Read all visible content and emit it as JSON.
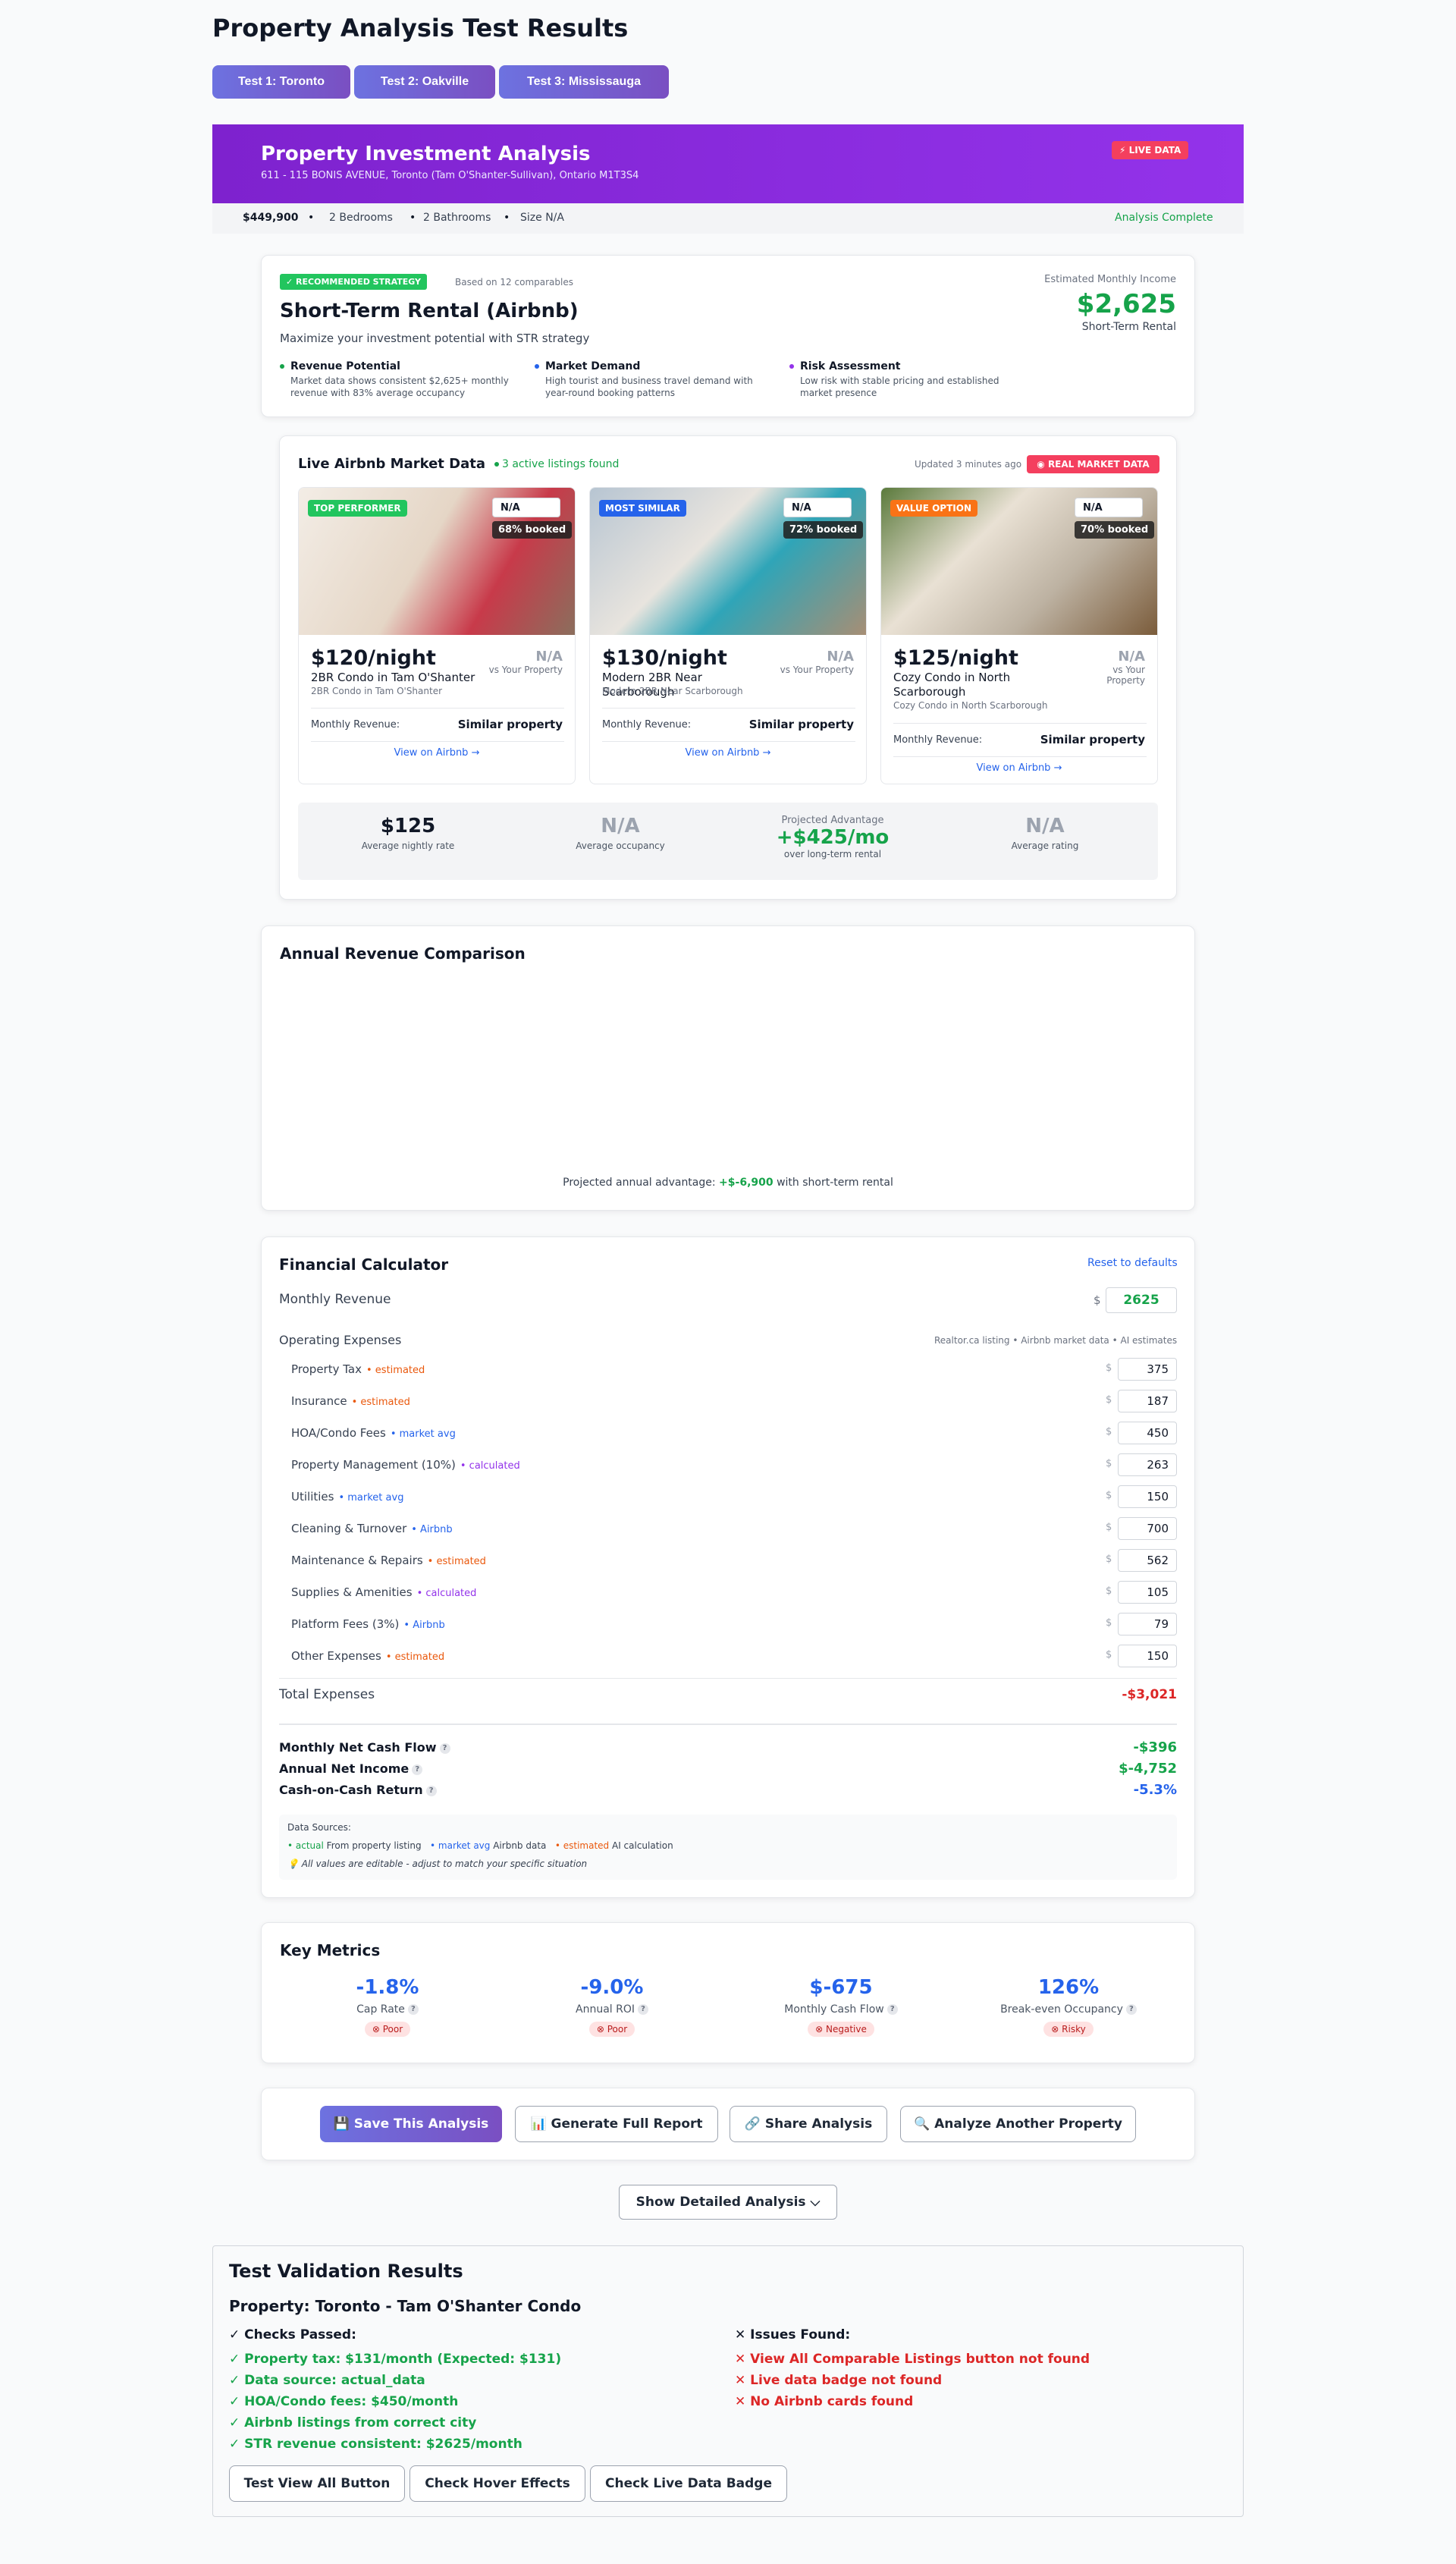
{
  "page_title": "Property Analysis Test Results",
  "tabs": [
    "Test 1: Toronto",
    "Test 2: Oakville",
    "Test 3: Mississauga"
  ],
  "banner": {
    "title": "Property Investment Analysis",
    "address": "611 - 115 BONIS AVENUE, Toronto (Tam O'Shanter-Sullivan), Ontario M1T3S4",
    "live_badge": "⚡ LIVE DATA"
  },
  "summary": {
    "price": "$449,900",
    "bedrooms": "2 Bedrooms",
    "bathrooms": "2 Bathrooms",
    "size": "Size N/A",
    "status": "Analysis Complete"
  },
  "strategy": {
    "badge": "✓ RECOMMENDED STRATEGY",
    "based_on": "Based on 12 comparables",
    "title": "Short-Term Rental (Airbnb)",
    "subtitle": "Maximize your investment potential with STR strategy",
    "income_label": "Estimated Monthly Income",
    "income_value": "$2,625",
    "income_type": "Short-Term Rental",
    "points": [
      {
        "title": "Revenue Potential",
        "text": "Market data shows consistent $2,625+ monthly revenue with 83% average occupancy",
        "color": "#16a34a"
      },
      {
        "title": "Market Demand",
        "text": "High tourist and business travel demand with year-round booking patterns",
        "color": "#2563eb"
      },
      {
        "title": "Risk Assessment",
        "text": "Low risk with stable pricing and established market presence",
        "color": "#9333ea"
      }
    ]
  },
  "market": {
    "title": "Live Airbnb Market Data",
    "active": "3 active listings found",
    "updated": "Updated 3 minutes ago",
    "real_badge": "◉ REAL MARKET DATA",
    "listings": [
      {
        "badge": "TOP PERFORMER",
        "badge_color": "#22c55e",
        "na": "N/A",
        "booked": "68% booked",
        "price": "$120/night",
        "title": "2BR Condo in Tam O'Shanter",
        "sub": "2BR Condo in Tam O'Shanter",
        "vs_na": "N/A",
        "vs": "vs Your Property",
        "rev_label": "Monthly Revenue:",
        "rev_value": "Similar property",
        "link": "View on Airbnb →"
      },
      {
        "badge": "MOST SIMILAR",
        "badge_color": "#2563eb",
        "na": "N/A",
        "booked": "72% booked",
        "price": "$130/night",
        "title": "Modern 2BR Near Scarborough",
        "sub": "Modern 2BR Near Scarborough",
        "vs_na": "N/A",
        "vs": "vs Your Property",
        "rev_label": "Monthly Revenue:",
        "rev_value": "Similar property",
        "link": "View on Airbnb →"
      },
      {
        "badge": "VALUE OPTION",
        "badge_color": "#f97316",
        "na": "N/A",
        "booked": "70% booked",
        "price": "$125/night",
        "title": "Cozy Condo in North Scarborough",
        "sub": "Cozy Condo in North Scarborough",
        "vs_na": "N/A",
        "vs": "vs Your Property",
        "rev_label": "Monthly Revenue:",
        "rev_value": "Similar property",
        "link": "View on Airbnb →"
      }
    ],
    "stats": [
      {
        "value": "$125",
        "label": "Average nightly rate"
      },
      {
        "value": "N/A",
        "label": "Average occupancy"
      },
      {
        "top": "Projected Advantage",
        "value": "+$425/mo",
        "label": "over long-term rental"
      },
      {
        "value": "N/A",
        "label": "Average rating"
      }
    ]
  },
  "revenue": {
    "title": "Annual Revenue Comparison",
    "footer_pre": "Projected annual advantage: ",
    "footer_val": "+$-6,900",
    "footer_post": " with short-term rental"
  },
  "calculator": {
    "title": "Financial Calculator",
    "reset": "Reset to defaults",
    "monthly_revenue_label": "Monthly Revenue",
    "monthly_revenue": "2625",
    "opex_label": "Operating Expenses",
    "opex_sources": "Realtor.ca listing • Airbnb market data • AI estimates",
    "expenses": [
      {
        "label": "Property Tax",
        "tag": "• estimated",
        "tag_type": "estimated",
        "value": "375"
      },
      {
        "label": "Insurance",
        "tag": "• estimated",
        "tag_type": "estimated",
        "value": "187"
      },
      {
        "label": "HOA/Condo Fees",
        "tag": "• market avg",
        "tag_type": "market",
        "value": "450"
      },
      {
        "label": "Property Management (10%)",
        "tag": "• calculated",
        "tag_type": "calculated",
        "value": "263"
      },
      {
        "label": "Utilities",
        "tag": "• market avg",
        "tag_type": "market",
        "value": "150"
      },
      {
        "label": "Cleaning & Turnover",
        "tag": "• Airbnb",
        "tag_type": "market",
        "value": "700"
      },
      {
        "label": "Maintenance & Repairs",
        "tag": "• estimated",
        "tag_type": "estimated",
        "value": "562"
      },
      {
        "label": "Supplies & Amenities",
        "tag": "• calculated",
        "tag_type": "calculated",
        "value": "105"
      },
      {
        "label": "Platform Fees (3%)",
        "tag": "• Airbnb",
        "tag_type": "market",
        "value": "79"
      },
      {
        "label": "Other Expenses",
        "tag": "• estimated",
        "tag_type": "estimated",
        "value": "150"
      }
    ],
    "currency": "$",
    "total_label": "Total Expenses",
    "total_value": "-$3,021",
    "net_cf_label": "Monthly Net Cash Flow",
    "net_cf_value": "-$396",
    "annual_label": "Annual Net Income",
    "annual_value": "$-4,752",
    "coc_label": "Cash-on-Cash Return",
    "coc_value": "-5.3%",
    "sources_title": "Data Sources:",
    "src_actual": "• actual",
    "src_actual_t": " From property listing",
    "src_market": "• market avg",
    "src_market_t": " Airbnb data",
    "src_est": "• estimated",
    "src_est_t": " AI calculation",
    "note": "💡 All values are editable - adjust to match your specific situation"
  },
  "metrics": {
    "title": "Key Metrics",
    "items": [
      {
        "value": "-1.8%",
        "label": "Cap Rate",
        "pill": "⊗ Poor"
      },
      {
        "value": "-9.0%",
        "label": "Annual ROI",
        "pill": "⊗ Poor"
      },
      {
        "value": "$-675",
        "label": "Monthly Cash Flow",
        "pill": "⊗ Negative"
      },
      {
        "value": "126%",
        "label": "Break-even Occupancy",
        "pill": "⊗ Risky"
      }
    ]
  },
  "actions": [
    "💾 Save This Analysis",
    "📊 Generate Full Report",
    "🔗 Share Analysis",
    "🔍 Analyze Another Property"
  ],
  "show_detailed": "Show Detailed Analysis",
  "validation": {
    "title": "Test Validation Results",
    "property": "Property: Toronto - Tam O'Shanter Condo",
    "passed_title": "✓ Checks Passed:",
    "issues_title": "✕ Issues Found:",
    "passed": [
      "✓ Property tax: $131/month (Expected: $131)",
      "✓ Data source: actual_data",
      "✓ HOA/Condo fees: $450/month",
      "✓ Airbnb listings from correct city",
      "✓ STR revenue consistent: $2625/month"
    ],
    "issues": [
      "✕ View All Comparable Listings button not found",
      "✕ Live data badge not found",
      "✕ No Airbnb cards found"
    ],
    "buttons": [
      "Test View All Button",
      "Check Hover Effects",
      "Check Live Data Badge"
    ]
  }
}
